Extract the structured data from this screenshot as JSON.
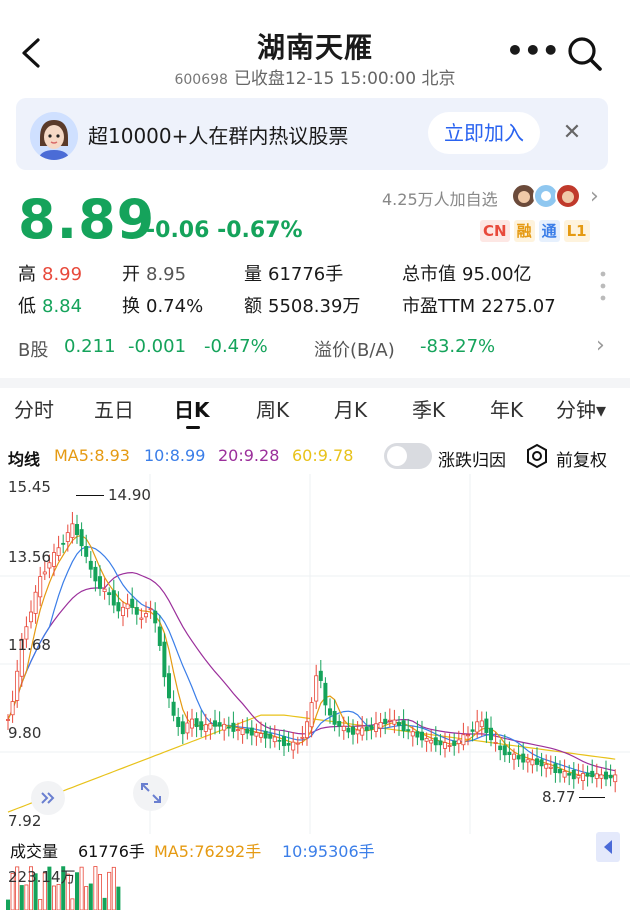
{
  "header": {
    "title": "湖南天雁",
    "code": "600698",
    "status": "已收盘12-15 15:00:00 北京"
  },
  "promo": {
    "text": "超10000+人在群内热议股票",
    "join_label": "立即加入",
    "close_label": "✕"
  },
  "quote": {
    "price": "8.89",
    "change": "-0.06",
    "change_pct": "-0.67%",
    "follow_text": "4.25万人加自选",
    "badges": [
      "CN",
      "融",
      "通",
      "L1"
    ],
    "stats": {
      "high_label": "高",
      "high": "8.99",
      "open_label": "开",
      "open": "8.95",
      "volume_label": "量",
      "volume": "61776手",
      "mktcap_label": "总市值",
      "mktcap": "95.00亿",
      "low_label": "低",
      "low": "8.84",
      "turnover_label": "换",
      "turnover": "0.74%",
      "amount_label": "额",
      "amount": "5508.39万",
      "pe_label": "市盈TTM",
      "pe": "2275.07"
    },
    "bshare": {
      "label": "B股",
      "price": "0.211",
      "change": "-0.001",
      "change_pct": "-0.47%",
      "premium_label": "溢价(B/A)",
      "premium": "-83.27%"
    }
  },
  "tabs": [
    "分时",
    "五日",
    "日K",
    "周K",
    "月K",
    "季K",
    "年K",
    "分钟▾"
  ],
  "active_tab": "日K",
  "indicators": {
    "label": "均线",
    "ma5": "MA5:8.93",
    "ma10": "10:8.99",
    "ma20": "20:9.28",
    "ma60": "60:9.78",
    "reason_label": "涨跌归因",
    "adjust_label": "前复权"
  },
  "chart": {
    "y_ticks": [
      "15.45",
      "13.56",
      "11.68",
      "9.80",
      "7.92"
    ],
    "max_label": "14.90",
    "min_label": "8.77",
    "colors": {
      "up": "#e8493b",
      "down": "#15a35b",
      "ma5": "#e59a12",
      "ma10": "#3b7ee8",
      "ma20": "#9b2f9b",
      "ma60": "#e8c21a"
    }
  },
  "volume": {
    "label": "成交量",
    "value": "61776手",
    "ma5": "MA5:76292手",
    "ma10": "10:95306手",
    "y_tick": "223.14万"
  }
}
